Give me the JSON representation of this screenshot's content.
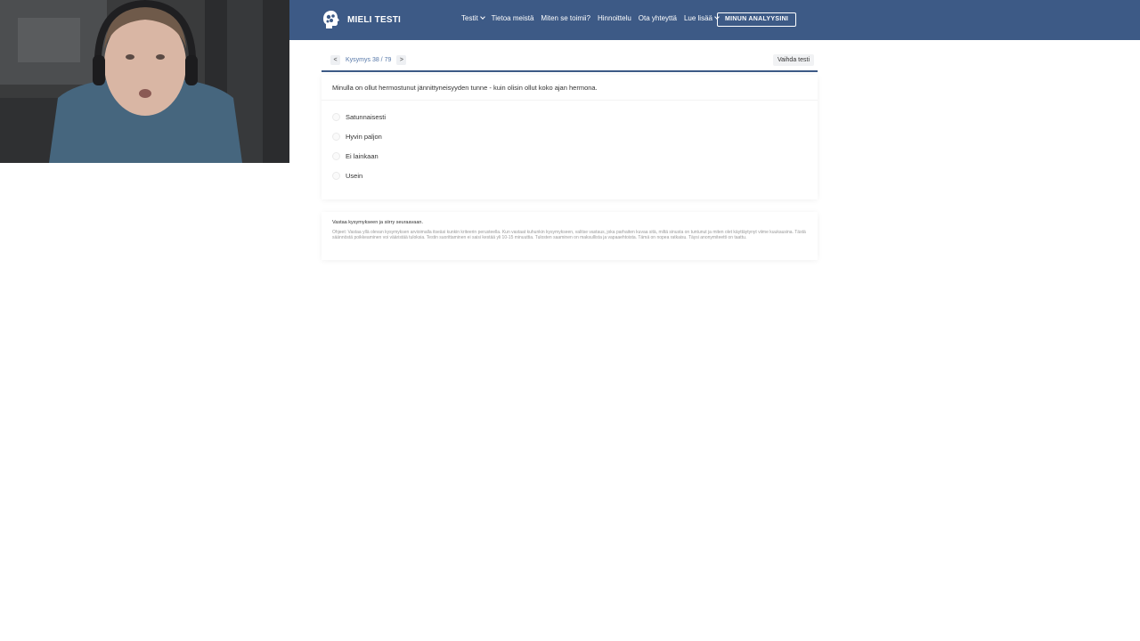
{
  "nav": {
    "logo_text": "MIELI TESTI",
    "links": [
      {
        "label": "Testit",
        "dropdown": true
      },
      {
        "label": "Tietoa meistä",
        "dropdown": false
      },
      {
        "label": "Miten se toimii?",
        "dropdown": false
      },
      {
        "label": "Hinnoittelu",
        "dropdown": false
      },
      {
        "label": "Ota yhteyttä",
        "dropdown": false
      },
      {
        "label": "Lue lisää",
        "dropdown": true
      }
    ],
    "cta_label": "MINUN ANALYYSINI"
  },
  "question_header": {
    "prev_label": "<",
    "counter": "Kysymys 38 / 79",
    "next_label": ">",
    "switch_label": "Vaihda testi"
  },
  "question": {
    "text": "Minulla on ollut hermostunut jännittyneisyyden tunne - kuin olisin ollut koko ajan hermona.",
    "options": [
      "Satunnaisesti",
      "Hyvin paljon",
      "Ei lainkaan",
      "Usein"
    ]
  },
  "info": {
    "title": "Vastaa kysymykseen ja siirry seuraavaan.",
    "body": "Ohjeet: Vastaa yllä olevan kysymyksen arvioimalla itseäsi kunkin kriteerin perusteella. Kun vastaat kuhunkin kysymykseen, valitse vastaus, joka parhaiten kuvaa sitä, miltä sinusta on tuntunut ja miten olet käyttäytynyt viime kuukausina. Tästä säännöstä poikkeaminen voi vääristää tuloksia. Testin suorittaminen ei saisi kestää yli 10-15 minuuttia. Tulosten saaminen on maksullista ja vapaaehtoista. Tämä on nopea ratkaisu. Täysi anonymiteetti on taattu."
  },
  "colors": {
    "navbar": "#3d5a86",
    "accent": "#5577a8",
    "text": "#333333",
    "muted": "#9a9a9a"
  },
  "icons": {
    "logo": "head-puzzle-icon",
    "caret": "chevron-down-icon"
  }
}
